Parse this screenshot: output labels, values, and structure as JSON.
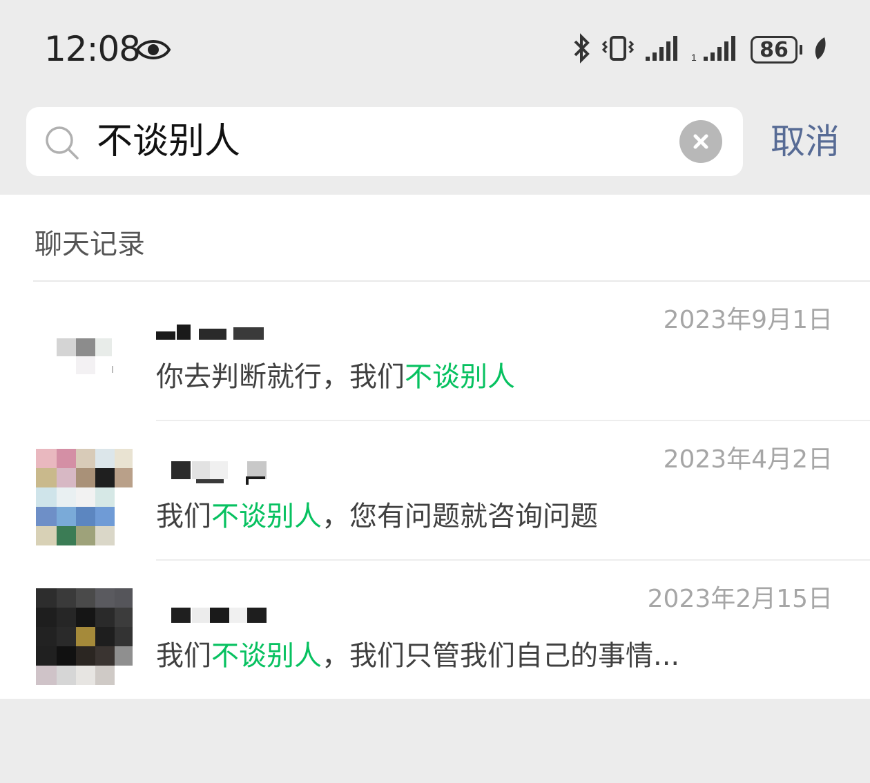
{
  "status_bar": {
    "time": "12:08",
    "battery": "86",
    "icons": [
      "eye-icon",
      "bluetooth-icon",
      "vibrate-icon",
      "signal-icon",
      "signal-icon",
      "battery-icon",
      "leaf-icon"
    ]
  },
  "search": {
    "query": "不谈别人",
    "cancel_label": "取消"
  },
  "results": {
    "section_title": "聊天记录",
    "items": [
      {
        "name": "",
        "date": "2023年9月1日",
        "snippet_before": "你去判断就行，我们",
        "snippet_match": "不谈别人",
        "snippet_after": ""
      },
      {
        "name": "",
        "date": "2023年4月2日",
        "snippet_before": "我们",
        "snippet_match": "不谈别人",
        "snippet_after": "，您有问题就咨询问题"
      },
      {
        "name": "",
        "date": "2023年2月15日",
        "snippet_before": "我们",
        "snippet_match": "不谈别人",
        "snippet_after": "，我们只管我们自己的事情..."
      }
    ]
  },
  "colors": {
    "highlight": "#07c160",
    "cancel": "#576b95",
    "background": "#ececec"
  }
}
